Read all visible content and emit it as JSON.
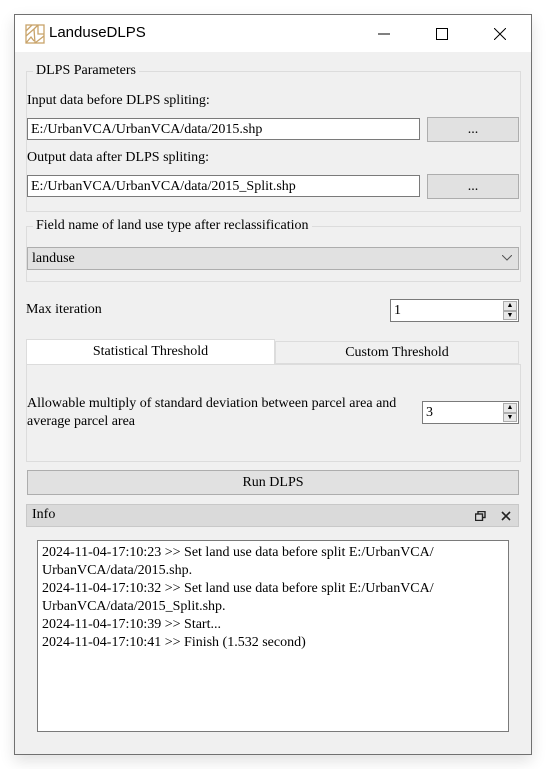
{
  "window": {
    "title": "LanduseDLPS",
    "icon": "app-parcel-icon",
    "controls": [
      "minimize-icon",
      "maximize-icon",
      "close-icon"
    ]
  },
  "params_group": {
    "title": "DLPS Parameters",
    "input_label": "Input data before DLPS spliting:",
    "input_value": "E:/UrbanVCA/UrbanVCA/data/2015.shp",
    "input_browse": "...",
    "output_label": "Output data after DLPS spliting:",
    "output_value": "E:/UrbanVCA/UrbanVCA/data/2015_Split.shp",
    "output_browse": "..."
  },
  "field_group": {
    "title": "Field name of land use type after reclassification",
    "selected": "landuse"
  },
  "max_iteration": {
    "label": "Max iteration",
    "value": "1"
  },
  "tabs": [
    {
      "label": "Statistical Threshold",
      "active": true
    },
    {
      "label": "Custom Threshold",
      "active": false
    }
  ],
  "threshold": {
    "label_line1": "Allowable multiply of standard deviation between parcel area and",
    "label_line2": "average parcel area",
    "value": "3"
  },
  "run_button": "Run DLPS",
  "info_panel": {
    "title": "Info",
    "log": [
      "2024-11-04-17:10:23 >> Set land use data before split E:/UrbanVCA/",
      "UrbanVCA/data/2015.shp.",
      "2024-11-04-17:10:32 >> Set land use data before split E:/UrbanVCA/",
      "UrbanVCA/data/2015_Split.shp.",
      "2024-11-04-17:10:39 >> Start...",
      "2024-11-04-17:10:41 >> Finish (1.532 second)"
    ]
  }
}
